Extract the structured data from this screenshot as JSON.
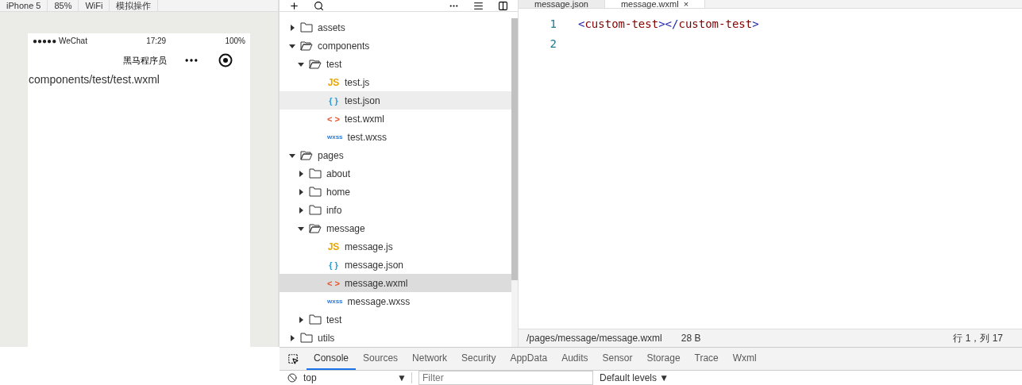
{
  "sim_toolbar": {
    "items": [
      "iPhone 5",
      "85%",
      "WiFi",
      "模拟操作"
    ]
  },
  "phone": {
    "carrier": "●●●●● WeChat",
    "time": "17:29",
    "battery": "100%",
    "nav_title": "黑马程序员",
    "content": "components/test/test.wxml"
  },
  "tree": [
    {
      "kind": "folder",
      "name": "assets",
      "expanded": false,
      "selected": false
    },
    {
      "kind": "folder",
      "name": "components",
      "expanded": true,
      "selected": false,
      "children": [
        {
          "kind": "folder",
          "name": "test",
          "expanded": true,
          "selected": false,
          "children": [
            {
              "kind": "file",
              "color": "#e8a600",
              "badge": "JS",
              "name": "test.js",
              "selected": false
            },
            {
              "kind": "file",
              "color": "#2a9fd6",
              "badge": "{ }",
              "name": "test.json",
              "selected": false,
              "hovered": true
            },
            {
              "kind": "file",
              "color": "#e5532d",
              "badge": "< >",
              "name": "test.wxml",
              "selected": false
            },
            {
              "kind": "file",
              "color": "#2a7ad6",
              "badge": "wxss",
              "name": "test.wxss",
              "selected": false
            }
          ]
        }
      ]
    },
    {
      "kind": "folder",
      "name": "pages",
      "expanded": true,
      "selected": false,
      "children": [
        {
          "kind": "folder",
          "name": "about",
          "expanded": false,
          "selected": false
        },
        {
          "kind": "folder",
          "name": "home",
          "expanded": false,
          "selected": false
        },
        {
          "kind": "folder",
          "name": "info",
          "expanded": false,
          "selected": false
        },
        {
          "kind": "folder",
          "name": "message",
          "expanded": true,
          "selected": false,
          "children": [
            {
              "kind": "file",
              "color": "#e8a600",
              "badge": "JS",
              "name": "message.js",
              "selected": false
            },
            {
              "kind": "file",
              "color": "#2a9fd6",
              "badge": "{ }",
              "name": "message.json",
              "selected": false
            },
            {
              "kind": "file",
              "color": "#e5532d",
              "badge": "< >",
              "name": "message.wxml",
              "selected": true
            },
            {
              "kind": "file",
              "color": "#2a7ad6",
              "badge": "wxss",
              "name": "message.wxss",
              "selected": false
            }
          ]
        },
        {
          "kind": "folder",
          "name": "test",
          "expanded": false,
          "selected": false
        }
      ]
    },
    {
      "kind": "folder",
      "name": "utils",
      "expanded": false,
      "selected": false
    }
  ],
  "editor": {
    "tabs": [
      {
        "label": "message.json",
        "selected": false
      },
      {
        "label": "message.wxml",
        "selected": true,
        "close": "×"
      }
    ],
    "lines": [
      {
        "number": "1",
        "tokens": [
          {
            "kind": "bracket",
            "text": "<"
          },
          {
            "kind": "tag",
            "text": "custom-test"
          },
          {
            "kind": "bracket",
            "text": "></"
          },
          {
            "kind": "tag",
            "text": "custom-test"
          },
          {
            "kind": "bracket",
            "text": ">"
          }
        ]
      },
      {
        "number": "2"
      }
    ],
    "status": {
      "path": "/pages/message/message.wxml",
      "size": "28 B",
      "position": "行 1，列 17"
    }
  },
  "devtools": {
    "tabs": [
      {
        "label": "Console",
        "selected": true
      },
      {
        "label": "Sources",
        "selected": false
      },
      {
        "label": "Network",
        "selected": false
      },
      {
        "label": "Security",
        "selected": false
      },
      {
        "label": "AppData",
        "selected": false
      },
      {
        "label": "Audits",
        "selected": false
      },
      {
        "label": "Sensor",
        "selected": false
      },
      {
        "label": "Storage",
        "selected": false
      },
      {
        "label": "Trace",
        "selected": false
      },
      {
        "label": "Wxml",
        "selected": false
      }
    ],
    "context": "top",
    "context_arrow": "▼",
    "filter_placeholder": "Filter",
    "levels": "Default levels ▼"
  }
}
